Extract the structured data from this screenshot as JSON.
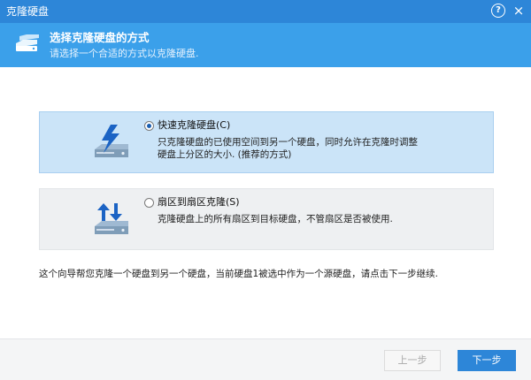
{
  "window": {
    "title": "克隆硬盘",
    "help_glyph": "?",
    "close_glyph": "×"
  },
  "header": {
    "icon": "disk-clone-icon",
    "title": "选择克隆硬盘的方式",
    "subtitle": "请选择一个合适的方式以克隆硬盘."
  },
  "options": [
    {
      "label": "快速克隆硬盘(C)",
      "description": "只克隆硬盘的已使用空间到另一个硬盘，同时允许在克隆时调整硬盘上分区的大小. (推荐的方式)",
      "selected": true,
      "icon": "lightning-disk-icon",
      "icon_color": "#1b63c4"
    },
    {
      "label": "扇区到扇区克隆(S)",
      "description": "克隆硬盘上的所有扇区到目标硬盘，不管扇区是否被使用.",
      "selected": false,
      "icon": "sector-transfer-disk-icon",
      "icon_color": "#1b63c4"
    }
  ],
  "info_text": "这个向导帮您克隆一个硬盘到另一个硬盘，当前硬盘1被选中作为一个源硬盘，请点击下一步继续.",
  "footer": {
    "back_label": "上一步",
    "next_label": "下一步"
  },
  "colors": {
    "titlebar": "#2d86d8",
    "header": "#3ba0ea",
    "selected_option": "#cbe4f8",
    "unselected_option": "#eef0f2"
  }
}
